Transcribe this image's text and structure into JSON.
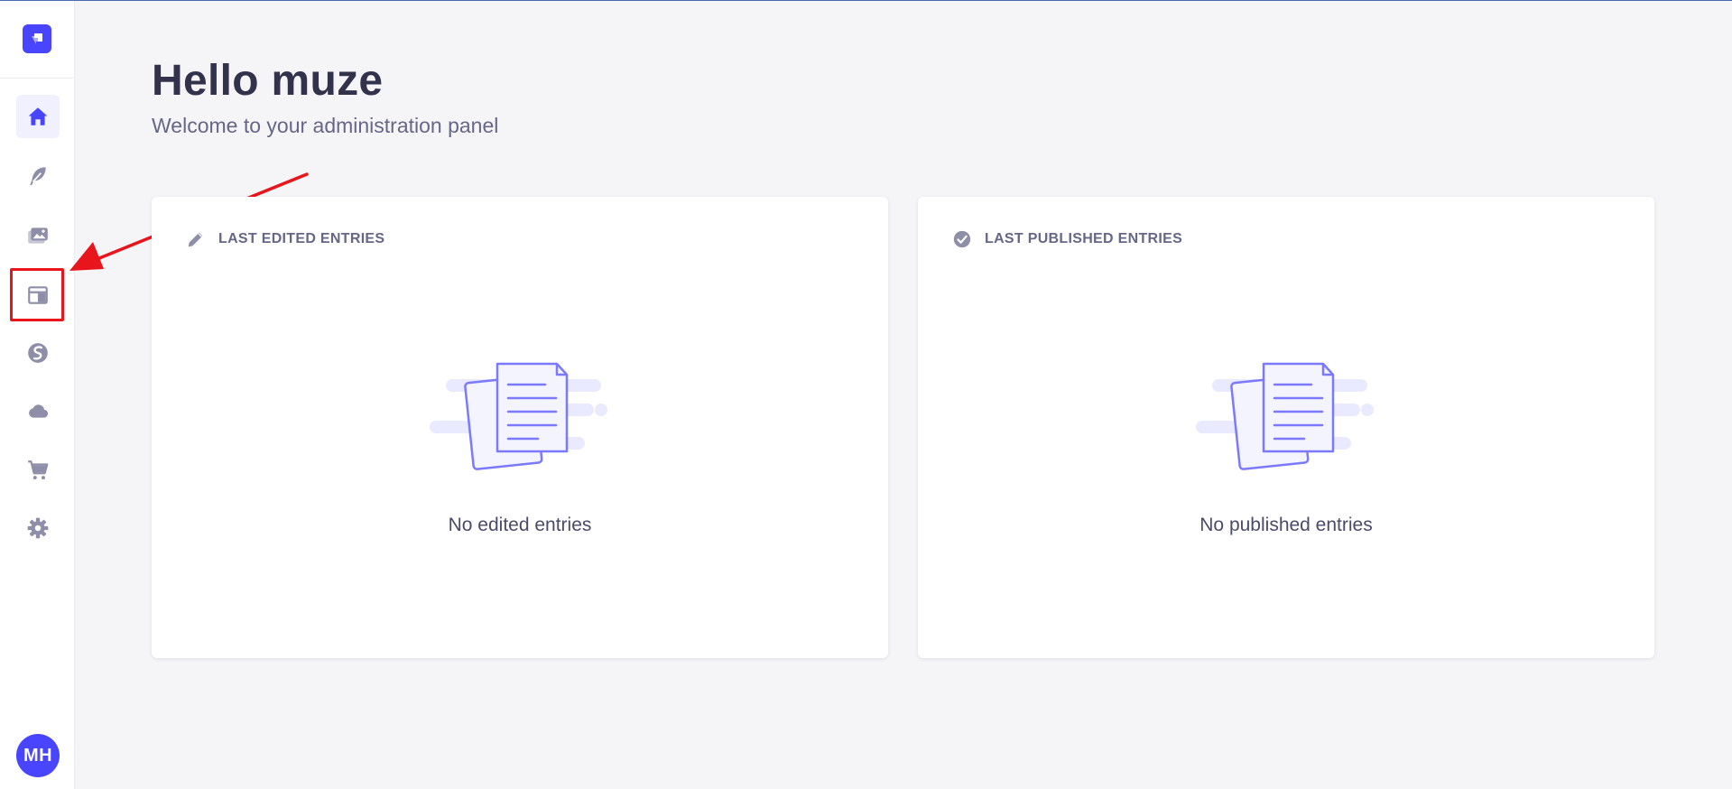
{
  "colors": {
    "primary": "#4945ff",
    "icon_gray": "#8e8ea9",
    "highlight_red": "#e8161c",
    "illustration_light": "#e9e9ff",
    "illustration_stroke": "#7b79ff"
  },
  "sidebar": {
    "brand_icon": "strapi-logo-icon",
    "items": [
      {
        "name": "home",
        "icon": "home-icon",
        "active": true
      },
      {
        "name": "content-manager",
        "icon": "feather-icon",
        "active": false
      },
      {
        "name": "media-library",
        "icon": "image-icon",
        "active": false
      },
      {
        "name": "content-type-builder",
        "icon": "layout-icon",
        "active": false,
        "highlighted": true
      },
      {
        "name": "plugin",
        "icon": "swirl-icon",
        "active": false
      },
      {
        "name": "cloud",
        "icon": "cloud-icon",
        "active": false
      },
      {
        "name": "marketplace",
        "icon": "cart-icon",
        "active": false
      },
      {
        "name": "settings",
        "icon": "gear-icon",
        "active": false
      }
    ],
    "user_initials": "MH"
  },
  "header": {
    "title": "Hello muze",
    "subtitle": "Welcome to your administration panel"
  },
  "cards": {
    "last_edited": {
      "icon": "pencil-icon",
      "title": "LAST EDITED ENTRIES",
      "empty_text": "No edited entries"
    },
    "last_published": {
      "icon": "check-circle-icon",
      "title": "LAST PUBLISHED ENTRIES",
      "empty_text": "No published entries"
    }
  }
}
